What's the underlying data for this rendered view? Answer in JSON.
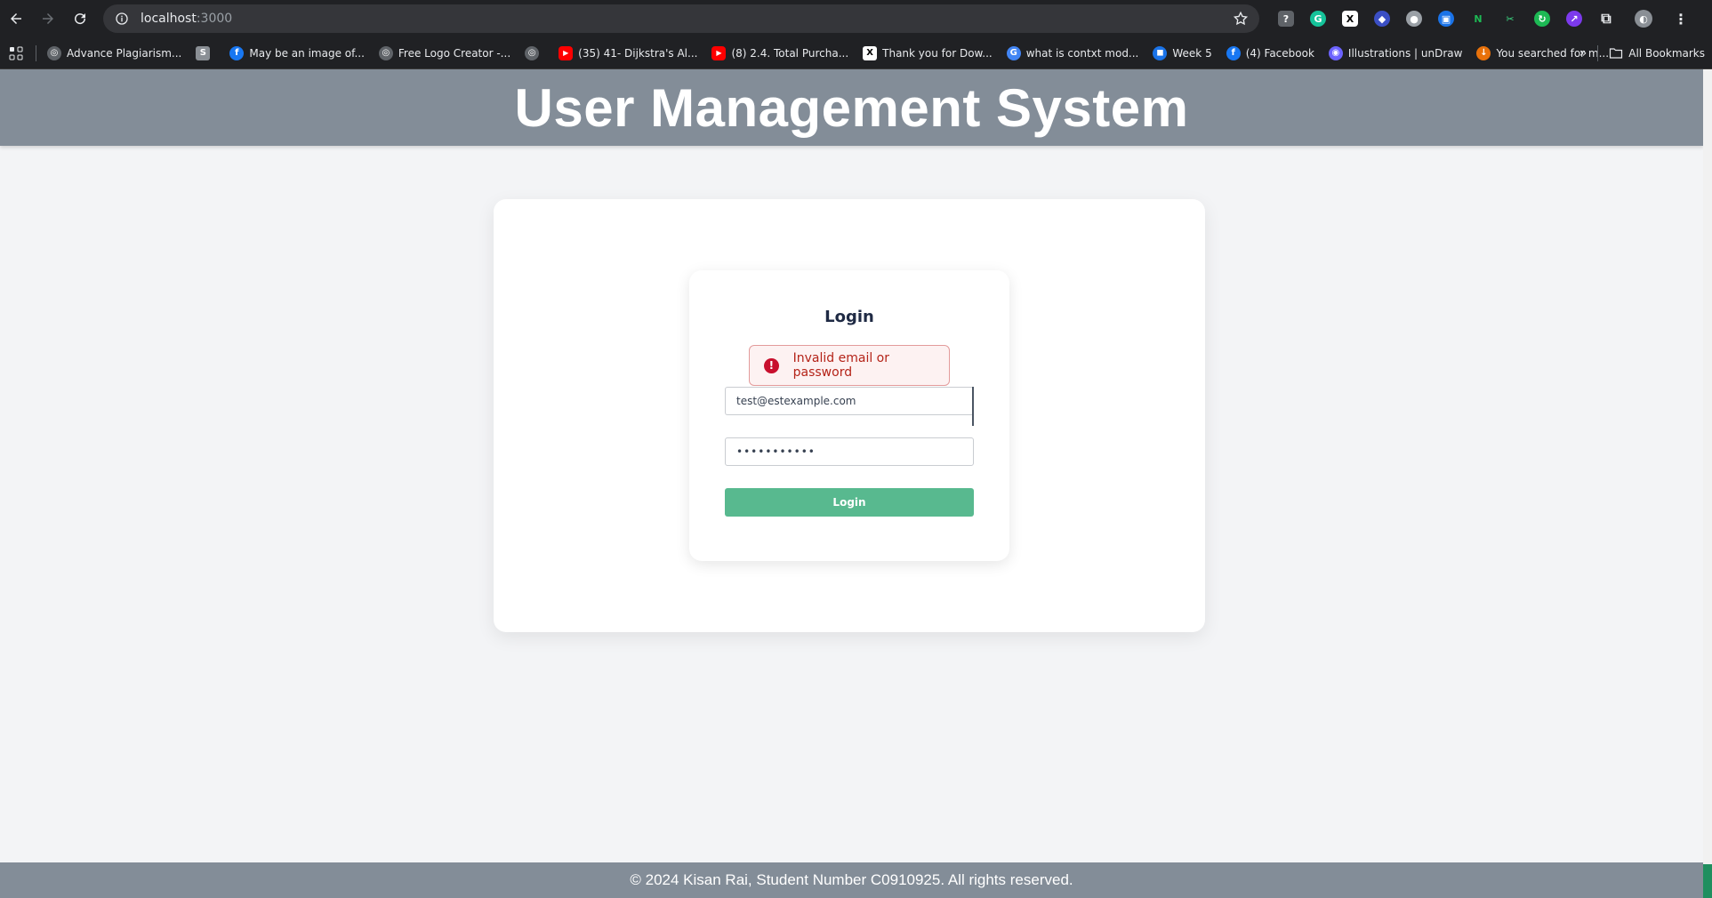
{
  "browser": {
    "url_host": "localhost",
    "url_port": ":3000",
    "bookmarks": [
      {
        "label": "Advance Plagiarism...",
        "icon": "globe-icon",
        "color": "#5f6368"
      },
      {
        "label": "",
        "icon": "sst-icon",
        "color": "#8a8f95"
      },
      {
        "label": "May be an image of...",
        "icon": "facebook-icon",
        "color": "#1877f2"
      },
      {
        "label": "Free Logo Creator -...",
        "icon": "globe-icon",
        "color": "#5f6368"
      },
      {
        "label": "",
        "icon": "globe-icon",
        "color": "#5f6368"
      },
      {
        "label": "(35) 41- Dijkstra's Al...",
        "icon": "youtube-icon",
        "color": "#ff0000"
      },
      {
        "label": "(8) 2.4. Total Purcha...",
        "icon": "youtube-icon",
        "color": "#ff0000"
      },
      {
        "label": "Thank you for Dow...",
        "icon": "x-icon",
        "color": "#ffffff"
      },
      {
        "label": "what is contxt mod...",
        "icon": "google-icon",
        "color": "#4285f4"
      },
      {
        "label": "Week 5",
        "icon": "classroom-icon",
        "color": "#1a73e8"
      },
      {
        "label": "(4) Facebook",
        "icon": "facebook-icon",
        "color": "#1877f2"
      },
      {
        "label": "Illustrations | unDraw",
        "icon": "undraw-icon",
        "color": "#6c63ff"
      },
      {
        "label": "You searched for m...",
        "icon": "download-icon",
        "color": "#e8710a"
      }
    ],
    "all_bookmarks_label": "All Bookmarks"
  },
  "header": {
    "title": "User Management System"
  },
  "login": {
    "title": "Login",
    "error_message": "Invalid email or password",
    "email_value": "test@estexample.com",
    "password_value": "•••••••••••",
    "button_label": "Login"
  },
  "footer": {
    "text": "© 2024 Kisan Rai, Student Number C0910925. All rights reserved."
  }
}
